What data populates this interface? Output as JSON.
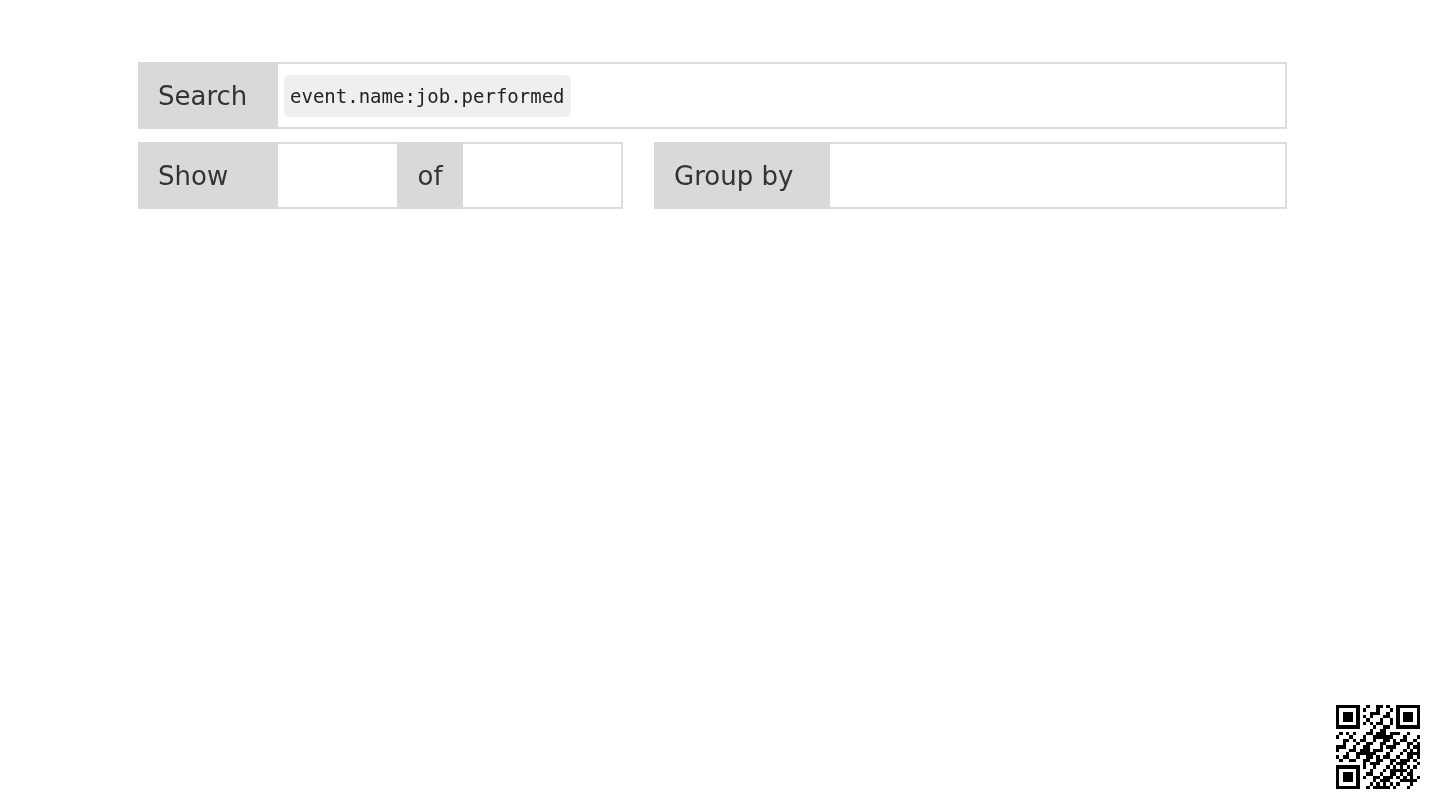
{
  "search": {
    "label": "Search",
    "token": "event.name:job.performed"
  },
  "show": {
    "label": "Show",
    "of_label": "of"
  },
  "group_by": {
    "label": "Group by"
  }
}
